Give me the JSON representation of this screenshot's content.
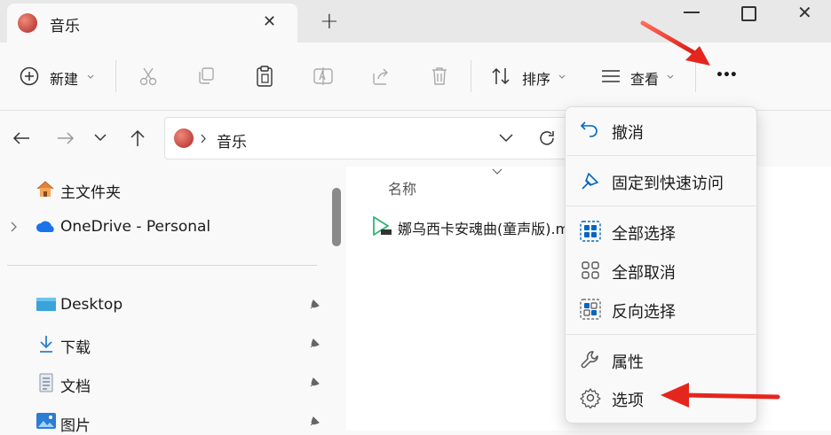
{
  "window": {
    "tab_title": "音乐",
    "tab_close": "✕",
    "new_tab": "+",
    "min": "—",
    "max": "□",
    "close": "✕"
  },
  "toolbar": {
    "new_label": "新建",
    "sort_label": "排序",
    "view_label": "查看",
    "more_label": "•••"
  },
  "address": {
    "path": [
      "音乐"
    ]
  },
  "nav": {
    "home": "主文件夹",
    "onedrive": "OneDrive - Personal",
    "desktop": "Desktop",
    "downloads": "下载",
    "documents": "文档",
    "pictures": "图片"
  },
  "content": {
    "column_name": "名称",
    "file_name": "娜乌西卡安魂曲(童声版).m"
  },
  "menu": {
    "items": [
      {
        "label": "撤消",
        "icon": "undo-icon"
      },
      {
        "label": "固定到快速访问",
        "icon": "pin-icon"
      },
      {
        "label": "全部选择",
        "icon": "select-all-icon"
      },
      {
        "label": "全部取消",
        "icon": "select-none-icon"
      },
      {
        "label": "反向选择",
        "icon": "invert-selection-icon"
      },
      {
        "label": "属性",
        "icon": "wrench-icon"
      },
      {
        "label": "选项",
        "icon": "gear-icon"
      }
    ]
  },
  "colors": {
    "accent": "#0067c0",
    "arrow_red": "#e5261e",
    "onedrive_blue": "#1a73e8"
  }
}
